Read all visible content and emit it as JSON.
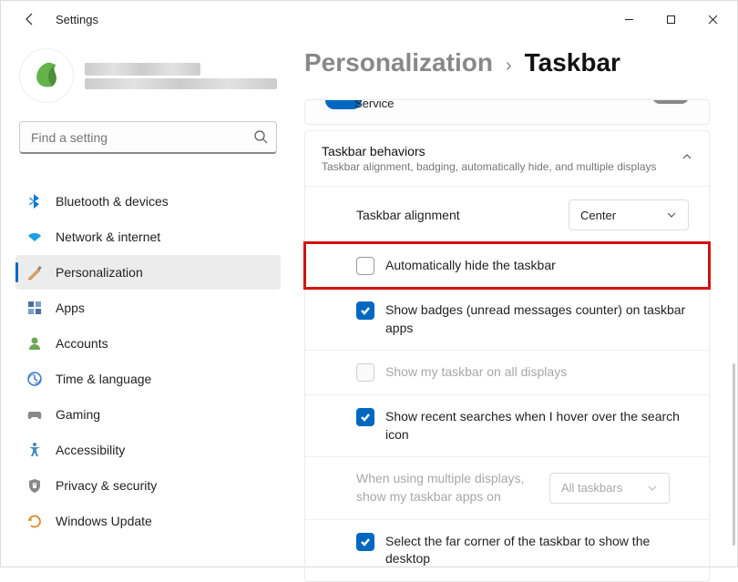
{
  "window": {
    "title": "Settings"
  },
  "search": {
    "placeholder": "Find a setting"
  },
  "nav": {
    "items": [
      {
        "label": "Bluetooth & devices"
      },
      {
        "label": "Network & internet"
      },
      {
        "label": "Personalization"
      },
      {
        "label": "Apps"
      },
      {
        "label": "Accounts"
      },
      {
        "label": "Time & language"
      },
      {
        "label": "Gaming"
      },
      {
        "label": "Accessibility"
      },
      {
        "label": "Privacy & security"
      },
      {
        "label": "Windows Update"
      }
    ]
  },
  "breadcrumb": {
    "parent": "Personalization",
    "current": "Taskbar"
  },
  "remnant": {
    "label": "Service"
  },
  "behaviors": {
    "title": "Taskbar behaviors",
    "desc": "Taskbar alignment, badging, automatically hide, and multiple displays",
    "alignment": {
      "label": "Taskbar alignment",
      "value": "Center"
    },
    "autohide": {
      "label": "Automatically hide the taskbar"
    },
    "badges": {
      "label": "Show badges (unread messages counter) on taskbar apps"
    },
    "alldisplays": {
      "label": "Show my taskbar on all displays"
    },
    "recent": {
      "label": "Show recent searches when I hover over the search icon"
    },
    "multidisp": {
      "label": "When using multiple displays, show my taskbar apps on",
      "value": "All taskbars"
    },
    "farcorner": {
      "label": "Select the far corner of the taskbar to show the desktop"
    }
  }
}
